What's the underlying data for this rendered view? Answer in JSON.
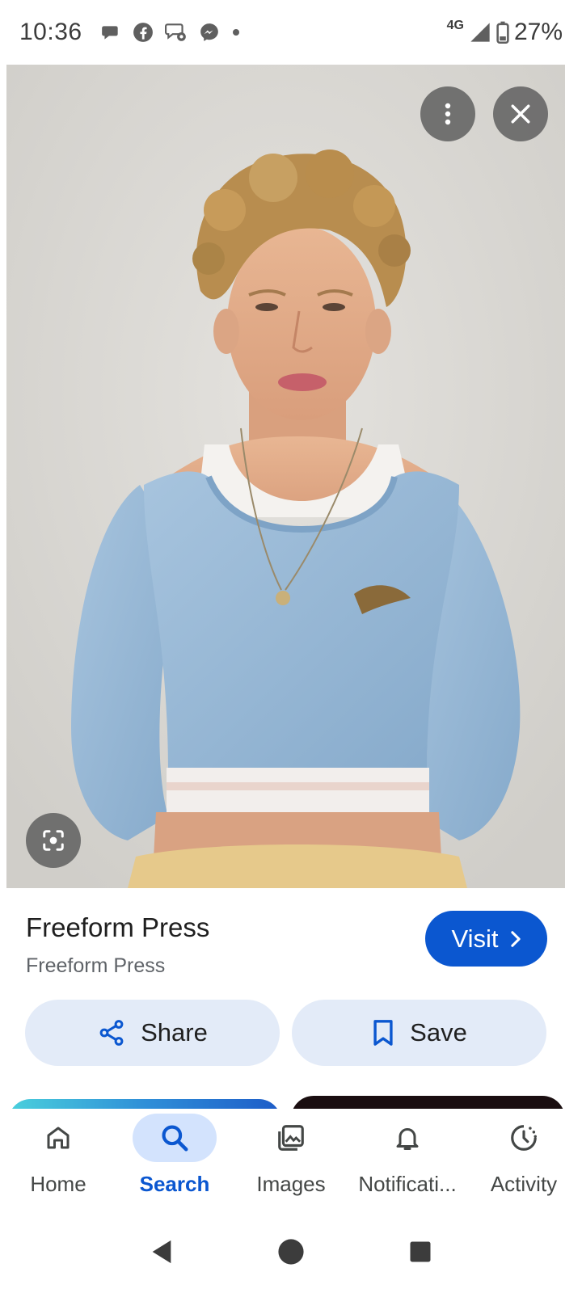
{
  "status_bar": {
    "time": "10:36",
    "network": "4G",
    "battery": "27%",
    "notification_icons": [
      "chat-bubble-icon",
      "facebook-icon",
      "chat-settings-icon",
      "messenger-icon",
      "dot-icon"
    ]
  },
  "viewer": {
    "more_icon": "more-vertical-icon",
    "close_icon": "close-icon",
    "lens_icon": "lens-icon"
  },
  "result": {
    "title": "Freeform Press",
    "source": "Freeform Press",
    "visit_label": "Visit",
    "share_label": "Share",
    "save_label": "Save"
  },
  "bottom_nav": {
    "items": [
      {
        "label": "Home",
        "icon": "home-icon",
        "active": false
      },
      {
        "label": "Search",
        "icon": "search-icon",
        "active": true
      },
      {
        "label": "Images",
        "icon": "images-icon",
        "active": false
      },
      {
        "label": "Notificati...",
        "icon": "bell-icon",
        "active": false
      },
      {
        "label": "Activity",
        "icon": "activity-icon",
        "active": false
      }
    ]
  },
  "colors": {
    "accent": "#0b57d0",
    "chip_bg": "#e3ebf8",
    "active_pill": "#d3e3fd"
  }
}
